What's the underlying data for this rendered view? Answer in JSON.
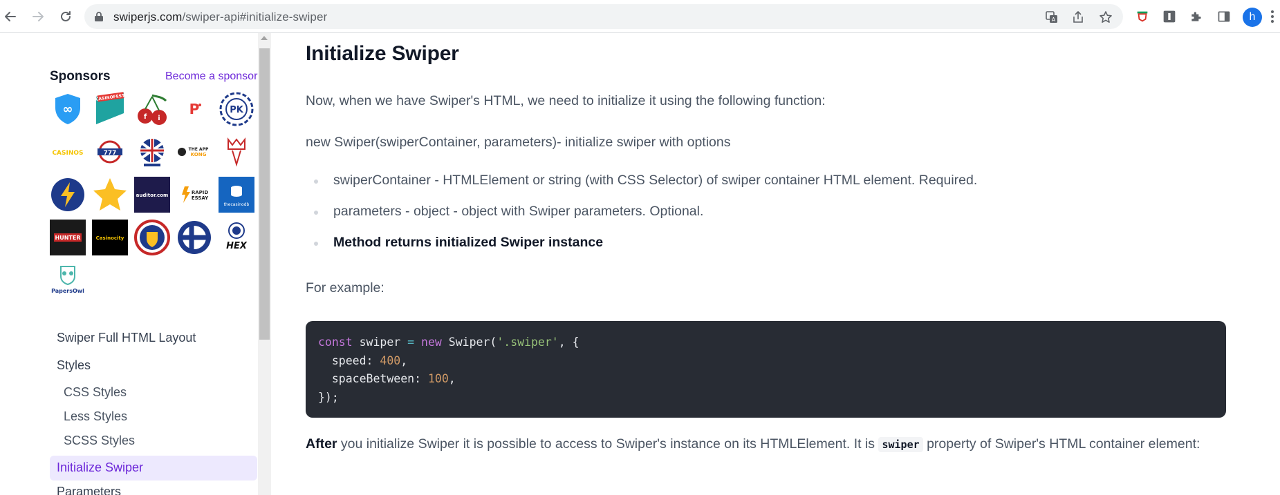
{
  "browser": {
    "url_host": "swiperjs.com",
    "url_path": "/swiper-api#initialize-swiper",
    "profile_initial": "h"
  },
  "sidebar": {
    "sponsors_title": "Sponsors",
    "become_sponsor": "Become a sponsor",
    "sponsor_logos": [
      {
        "label": ""
      },
      {
        "label": "CASINOFEST"
      },
      {
        "label": "fi"
      },
      {
        "label": ""
      },
      {
        "label": "PK"
      },
      {
        "label": "CASINOS"
      },
      {
        "label": "777"
      },
      {
        "label": ""
      },
      {
        "label": "THE APP KONG"
      },
      {
        "label": ""
      },
      {
        "label": ""
      },
      {
        "label": ""
      },
      {
        "label": "auditor.com"
      },
      {
        "label": "RAPID ESSAY"
      },
      {
        "label": "thecasinodb"
      },
      {
        "label": "HUNTER"
      },
      {
        "label": "Casinocity"
      },
      {
        "label": ""
      },
      {
        "label": ""
      },
      {
        "label": "HEX"
      },
      {
        "label": "PapersOwl"
      }
    ],
    "nav": [
      {
        "label": "Swiper Full HTML Layout",
        "level": 0
      },
      {
        "label": "Styles",
        "level": 0
      },
      {
        "label": "CSS Styles",
        "level": 1
      },
      {
        "label": "Less Styles",
        "level": 1
      },
      {
        "label": "SCSS Styles",
        "level": 1
      },
      {
        "label": "Initialize Swiper",
        "level": 0,
        "active": true
      },
      {
        "label": "Parameters",
        "level": 0
      }
    ]
  },
  "main": {
    "heading": "Initialize Swiper",
    "intro": "Now, when we have Swiper's HTML, we need to initialize it using the following function:",
    "signature": "new Swiper(swiperContainer, parameters)- initialize swiper with options",
    "bullets": [
      {
        "text": "swiperContainer - HTMLElement or string (with CSS Selector) of swiper container HTML element. Required.",
        "strong": false
      },
      {
        "text": "parameters - object - object with Swiper parameters. Optional.",
        "strong": false
      },
      {
        "text": "Method returns initialized Swiper instance",
        "strong": true
      }
    ],
    "for_example": "For example:",
    "code": {
      "kw_const": "const",
      "var_name": " swiper ",
      "op_eq": "=",
      "kw_new": " new",
      "class_name": " Swiper(",
      "selector": "'.swiper'",
      "open_brace": ", {",
      "speed_key": "  speed: ",
      "speed_val": "400",
      "space_key": "  spaceBetween: ",
      "space_val": "100",
      "comma": ",",
      "close": "});"
    },
    "after": {
      "bold": "After",
      "text1": " you initialize Swiper it is possible to access to Swiper's instance on its HTMLElement. It is ",
      "code": "swiper",
      "text2": " property of Swiper's HTML container element:"
    }
  },
  "colors": {
    "accent": "#6d28d9",
    "active_bg": "#ede9fe",
    "code_bg": "#282c34"
  }
}
